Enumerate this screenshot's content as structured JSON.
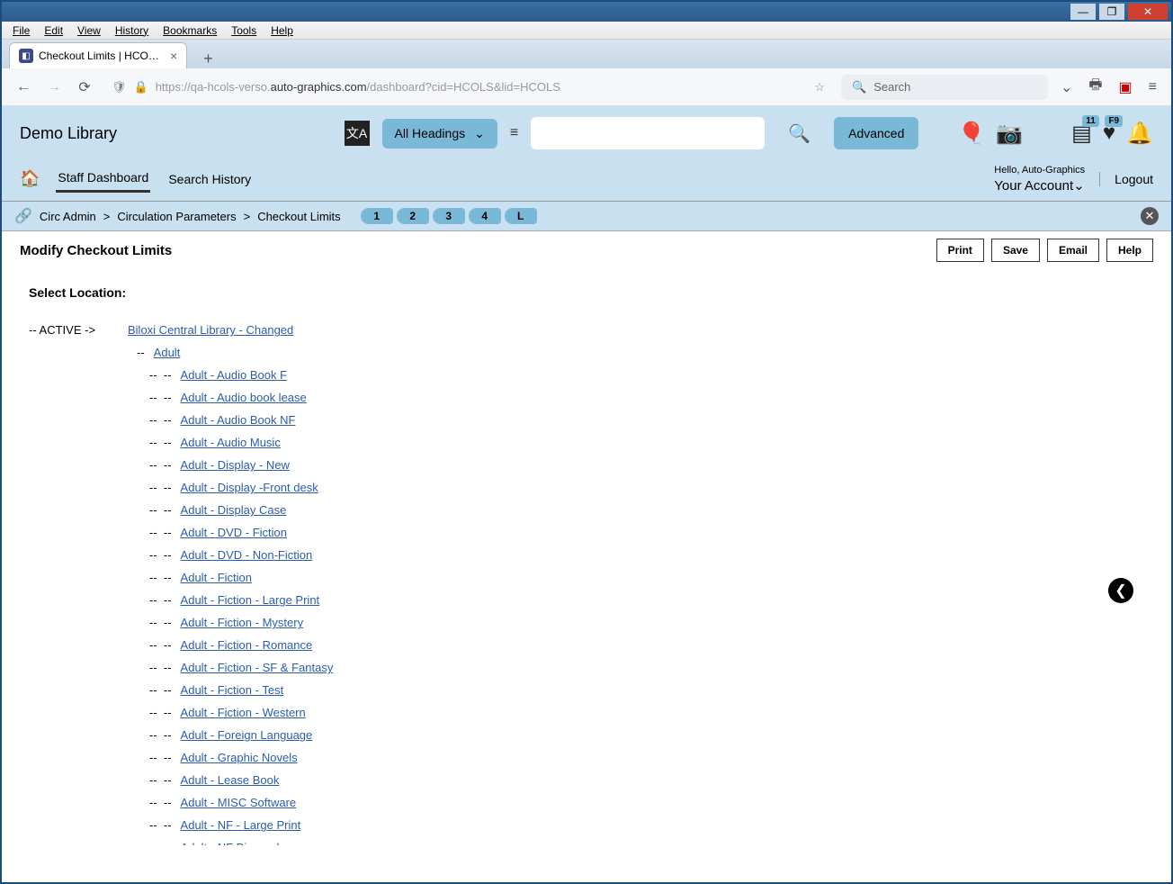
{
  "menubar": [
    "File",
    "Edit",
    "View",
    "History",
    "Bookmarks",
    "Tools",
    "Help"
  ],
  "tab": {
    "title": "Checkout Limits | HCOLS | hcol"
  },
  "url": {
    "prefix": "https://qa-hcols-verso.",
    "domain": "auto-graphics.com",
    "path": "/dashboard?cid=HCOLS&lid=HCOLS"
  },
  "browser_search_placeholder": "Search",
  "library_name": "Demo Library",
  "headings_label": "All Headings",
  "advanced_label": "Advanced",
  "badges": {
    "card": "11",
    "heart": "F9"
  },
  "nav": {
    "staff_dashboard": "Staff Dashboard",
    "search_history": "Search History"
  },
  "account": {
    "greeting": "Hello, Auto-Graphics",
    "label": "Your Account",
    "logout": "Logout"
  },
  "breadcrumb": {
    "a": "Circ Admin",
    "b": "Circulation Parameters",
    "c": "Checkout Limits"
  },
  "history_pills": [
    "1",
    "2",
    "3",
    "4",
    "L"
  ],
  "page_title": "Modify Checkout Limits",
  "buttons": {
    "print": "Print",
    "save": "Save",
    "email": "Email",
    "help": "Help"
  },
  "select_location": "Select Location:",
  "active_label": "-- ACTIVE ->",
  "root_location": "Biloxi Central Library - Changed",
  "adult_label": "Adult",
  "sub_locations": [
    "Adult - Audio Book F",
    "Adult - Audio book lease",
    "Adult - Audio Book NF",
    "Adult - Audio Music",
    "Adult - Display - New",
    "Adult - Display -Front desk",
    "Adult - Display Case",
    "Adult - DVD - Fiction",
    "Adult - DVD - Non-Fiction",
    "Adult - Fiction",
    "Adult - Fiction - Large Print",
    "Adult - Fiction - Mystery",
    "Adult - Fiction - Romance",
    "Adult - Fiction - SF & Fantasy",
    "Adult - Fiction - Test",
    "Adult - Fiction - Western",
    "Adult - Foreign Language",
    "Adult - Graphic Novels",
    "Adult - Lease Book",
    "Adult - MISC Software",
    "Adult - NF - Large Print",
    "Adult - NF Biography"
  ]
}
